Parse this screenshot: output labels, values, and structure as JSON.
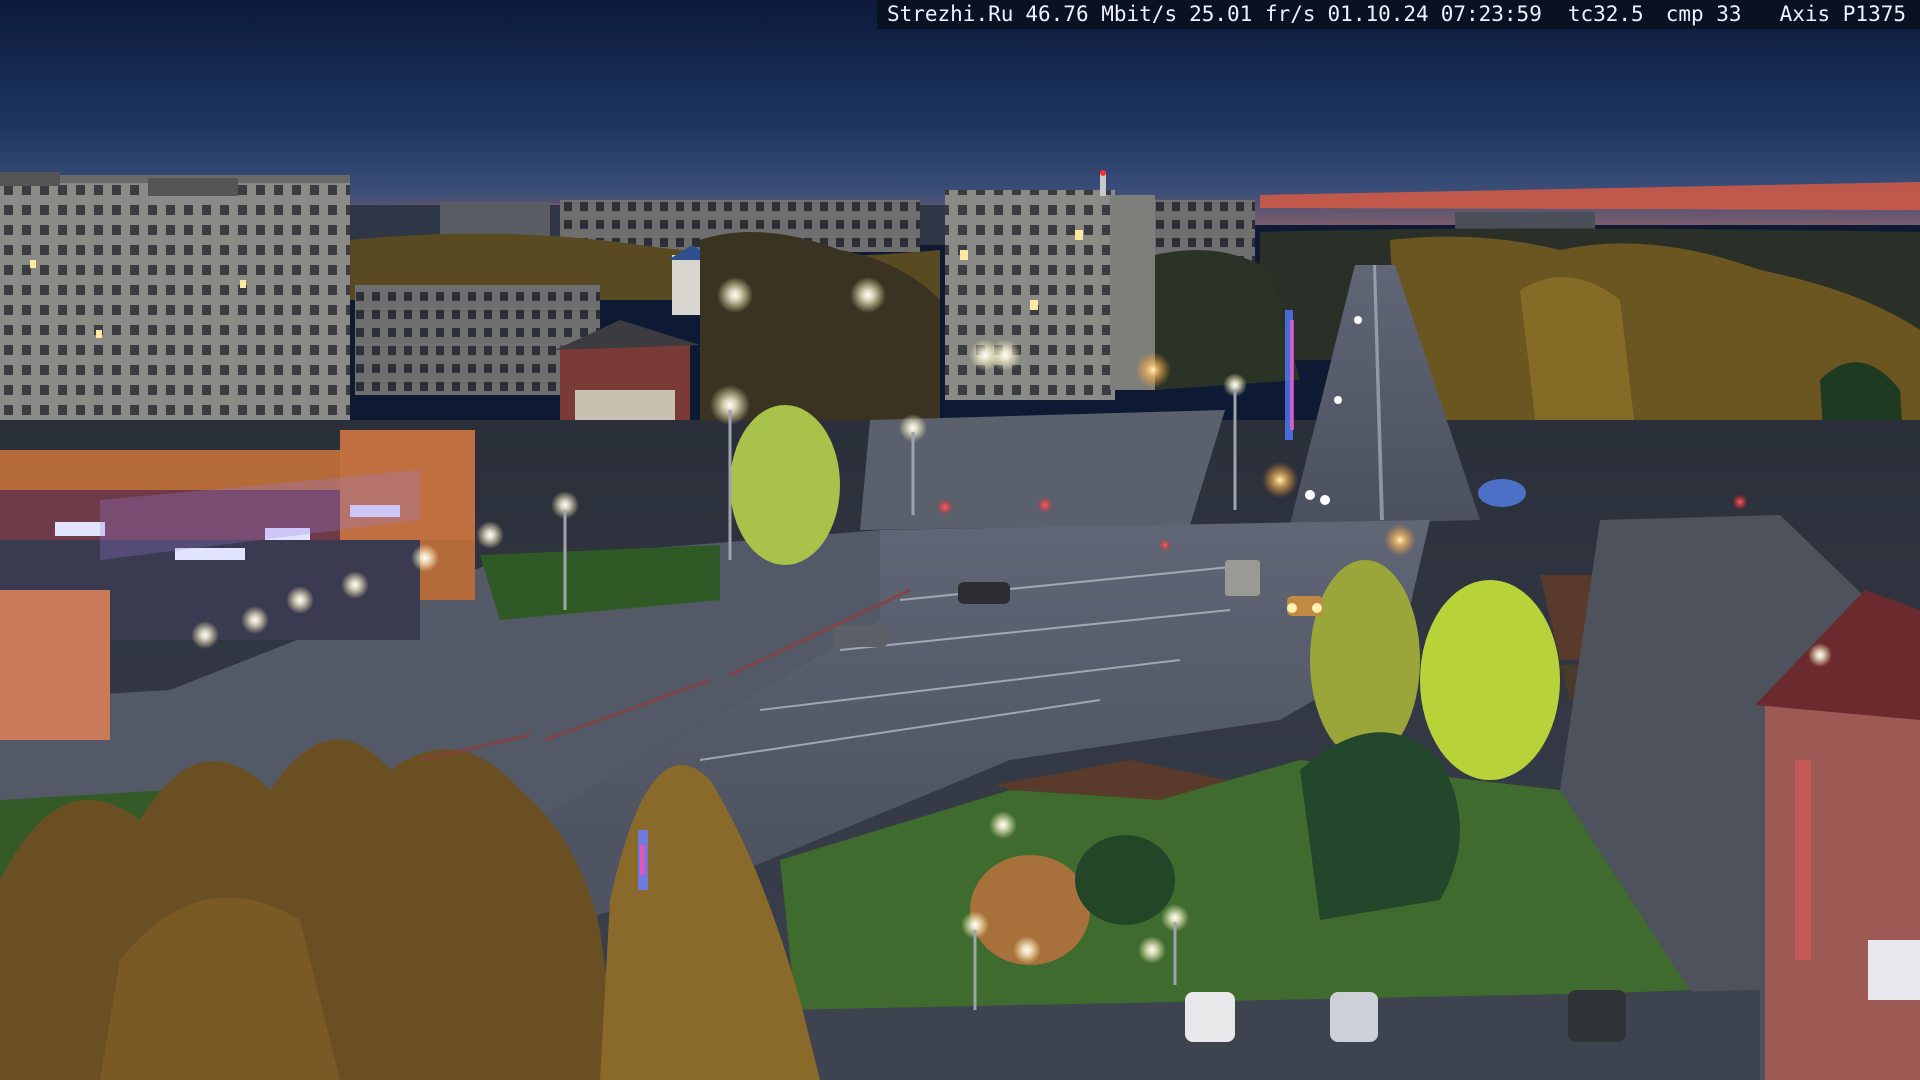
{
  "camera_overlay": {
    "site": "Strezhi.Ru",
    "bitrate": "46.76 Mbit/s",
    "framerate": "25.01 fr/s",
    "date": "01.10.24",
    "time": "07:23:59",
    "tc": "tc32.5",
    "cmp": "cmp 33",
    "camera_model": "Axis P1375"
  },
  "colors": {
    "sky_top": "#0f1d3f",
    "sky_horizon": "#e8634a",
    "asphalt": "#4a4f5c",
    "grass": "#3f6b2e",
    "tree_autumn": "#8a6a2a",
    "tree_lit": "#b8d23a",
    "streetlight": "#f4f1dc",
    "shop_neon": "#9a7fe0"
  }
}
